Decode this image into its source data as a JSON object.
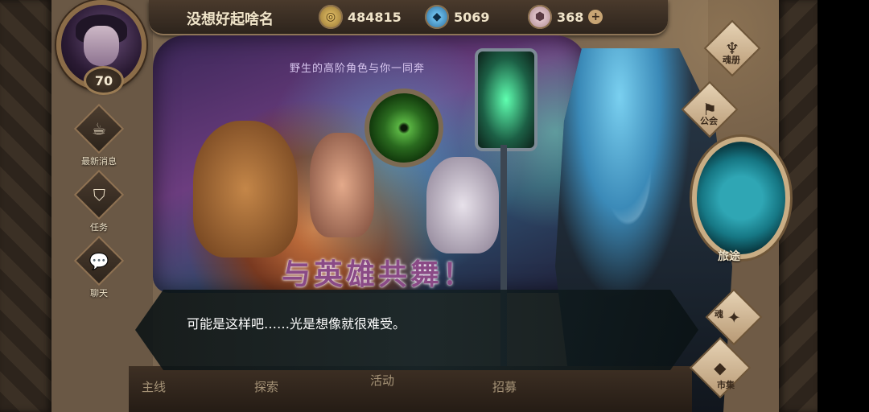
{
  "player": {
    "name": "没想好起啥名",
    "level": "70"
  },
  "resources": {
    "gold": {
      "icon": "gold-coin-icon",
      "value": "484815"
    },
    "crystal": {
      "icon": "blue-crystal-icon",
      "value": "5069"
    },
    "gem": {
      "icon": "pink-gem-icon",
      "value": "368",
      "add": "+"
    }
  },
  "side_menu": [
    {
      "label": "最新消息",
      "icon": "news-icon",
      "glyph": "☕"
    },
    {
      "label": "任务",
      "icon": "quest-icon",
      "glyph": "⛉"
    },
    {
      "label": "聊天",
      "icon": "chat-icon",
      "glyph": "💬"
    }
  ],
  "banner": {
    "subtitle": "野生的高阶角色与你一同奔",
    "title": "与英雄共舞！"
  },
  "right_menu": {
    "soul_book": {
      "label": "魂册",
      "icon": "soul-book-icon",
      "glyph": "♆"
    },
    "guild": {
      "label": "公会",
      "icon": "guild-icon",
      "glyph": "⚑"
    },
    "journey": {
      "label": "旅途",
      "icon": "journey-icon"
    },
    "soul": {
      "label": "魂",
      "icon": "soul-icon",
      "glyph": "✦"
    },
    "market": {
      "label": "市集",
      "icon": "market-icon",
      "glyph": "◆"
    }
  },
  "dialog": {
    "text": "可能是这样吧……光是想像就很难受。"
  },
  "bottom_tabs": [
    "主线",
    "探索",
    "活动",
    "招募"
  ],
  "colors": {
    "accent_gold": "#8b6c48",
    "teal": "#2fa6b4",
    "dialog_bg": "#14222a"
  }
}
